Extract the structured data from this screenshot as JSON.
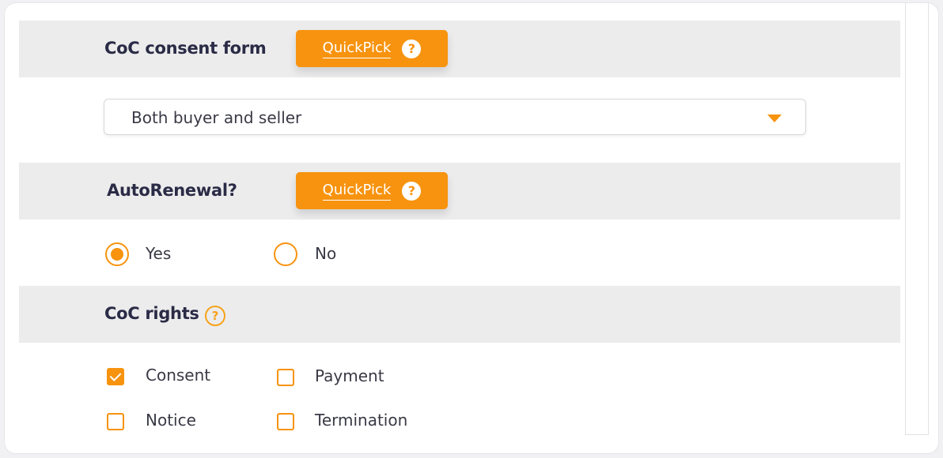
{
  "coc_consent_form": {
    "title": "CoC consent form",
    "quickpick_label": "QuickPick",
    "help_icon": "?",
    "select": {
      "value": "Both buyer and seller"
    }
  },
  "auto_renewal": {
    "title": "AutoRenewal?",
    "quickpick_label": "QuickPick",
    "help_icon": "?",
    "options": [
      {
        "label": "Yes",
        "selected": true
      },
      {
        "label": "No",
        "selected": false
      }
    ]
  },
  "coc_rights": {
    "title": "CoC rights",
    "help_icon": "?",
    "checkboxes": [
      {
        "label": "Consent",
        "checked": true
      },
      {
        "label": "Payment",
        "checked": false
      },
      {
        "label": "Notice",
        "checked": false
      },
      {
        "label": "Termination",
        "checked": false
      }
    ]
  },
  "colors": {
    "accent": "#f7930f",
    "header_bg": "#ececed",
    "title_text": "#2a2b45"
  }
}
